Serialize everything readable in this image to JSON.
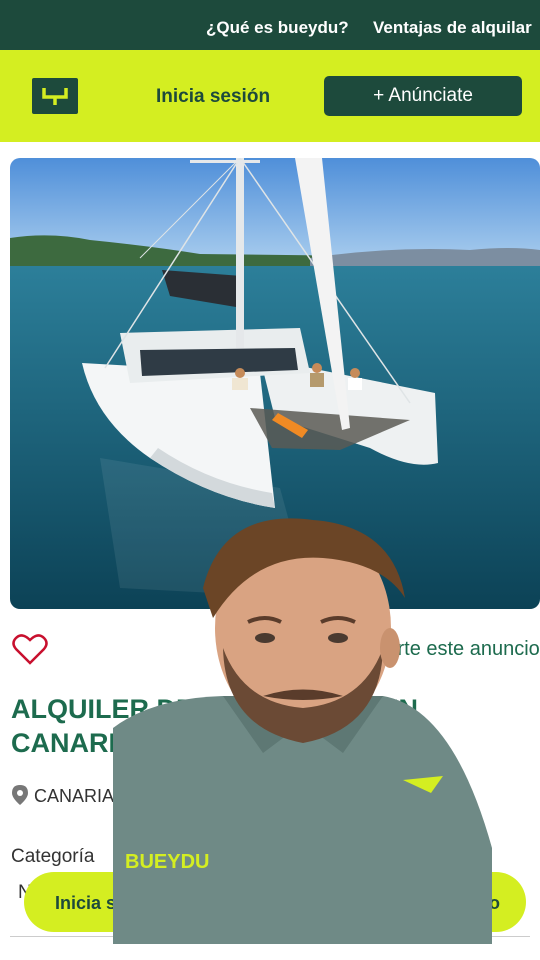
{
  "topnav": {
    "links": [
      "¿Qué es bueydu?",
      "Ventajas de alquilar"
    ]
  },
  "header": {
    "login_label": "Inicia sesión",
    "post_ad_label": "+ Anúnciate"
  },
  "listing": {
    "share_label": "Comparte este anuncio",
    "title_line1": "ALQUILER DE CATAMARAN EN",
    "title_line2": "CANARIAS",
    "location": "CANARIAS",
    "category_label": "Categoría",
    "stray_text": "N"
  },
  "bottom_bar": {
    "left_label": "Inicia sesión",
    "right_label": "o"
  },
  "overlay": {
    "shirt_text": "BUEYDU"
  },
  "colors": {
    "brand_dark": "#1d4a3c",
    "brand_lime": "#d4ee21",
    "accent_green": "#1d6b4e",
    "heart_red": "#c8102e"
  },
  "icons": {
    "logo": "bueydu-logo-icon",
    "favorite": "heart-icon",
    "location": "location-pin-icon"
  }
}
